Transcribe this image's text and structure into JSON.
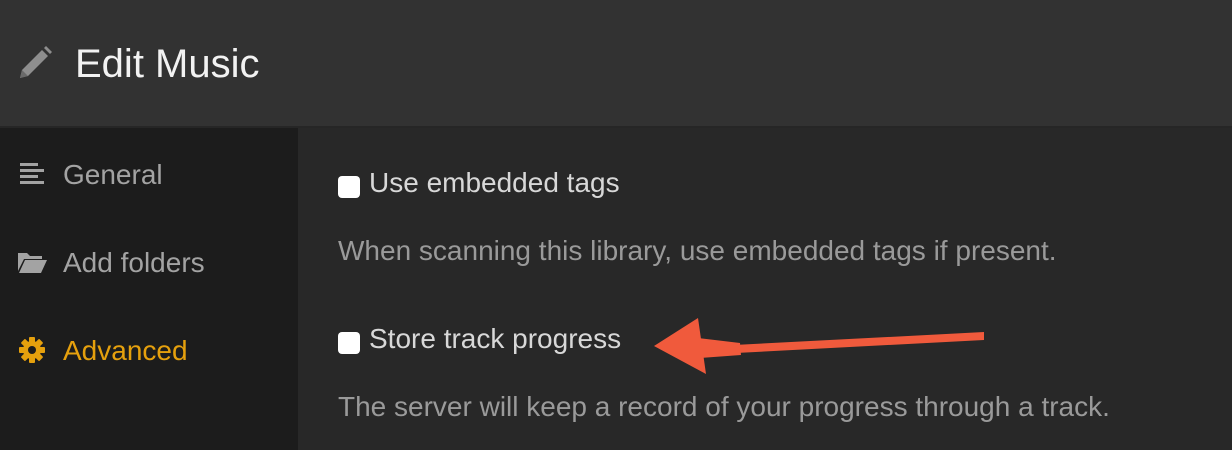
{
  "header": {
    "icon": "pencil-icon",
    "title": "Edit Music"
  },
  "sidebar": {
    "items": [
      {
        "label": "General",
        "icon": "align-icon",
        "active": false
      },
      {
        "label": "Add folders",
        "icon": "folder-icon",
        "active": false
      },
      {
        "label": "Advanced",
        "icon": "gear-icon",
        "active": true
      }
    ]
  },
  "options": [
    {
      "label": "Use embedded tags",
      "checked": false,
      "help": "When scanning this library, use embedded tags if present."
    },
    {
      "label": "Store track progress",
      "checked": false,
      "help": "The server will keep a record of your progress through a track."
    }
  ],
  "colors": {
    "accent": "#e5a00d",
    "annotation_arrow": "#f05a3c"
  }
}
